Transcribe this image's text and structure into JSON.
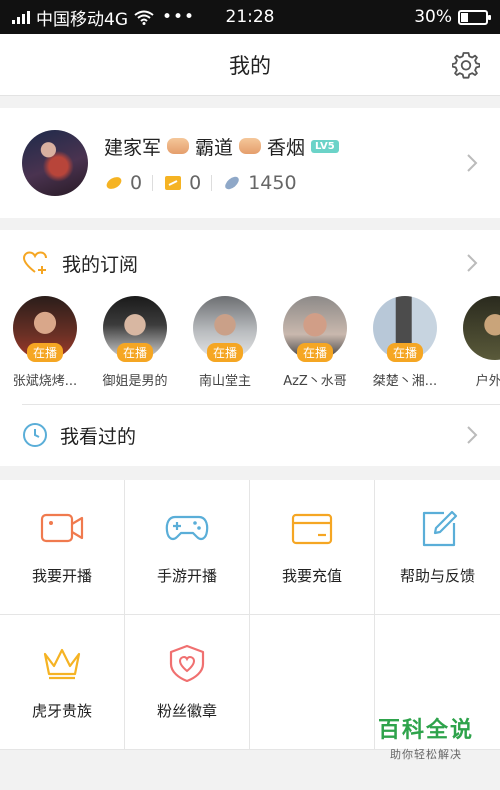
{
  "status_bar": {
    "carrier": "中国移动4G",
    "dots": "•••",
    "time": "21:28",
    "battery_percent": "30%",
    "battery_level": 0.3
  },
  "header": {
    "title": "我的",
    "settings_icon": "gear-icon"
  },
  "profile": {
    "name_parts": [
      "建家军",
      "霸道",
      "香烟"
    ],
    "level_badge": "LV5",
    "stats": [
      {
        "icon": "gold-bean-icon",
        "value": "0"
      },
      {
        "icon": "gold-ticket-icon",
        "value": "0"
      },
      {
        "icon": "silver-bean-icon",
        "value": "1450"
      }
    ]
  },
  "subscriptions": {
    "title": "我的订阅",
    "icon": "heart-plus-icon",
    "anchors": [
      {
        "name": "张斌烧烤...",
        "badge": "在播"
      },
      {
        "name": "御姐是男的",
        "badge": "在播"
      },
      {
        "name": "南山堂主",
        "badge": "在播"
      },
      {
        "name": "AzZ丶水哥",
        "badge": "在播"
      },
      {
        "name": "桀楚丶湘...",
        "badge": "在播"
      },
      {
        "name": "户外...",
        "badge": ""
      }
    ]
  },
  "history": {
    "title": "我看过的",
    "icon": "clock-icon"
  },
  "menu": [
    {
      "label": "我要开播",
      "icon": "video-camera-icon",
      "color": "#f07a4e"
    },
    {
      "label": "手游开播",
      "icon": "gamepad-icon",
      "color": "#5aaed8"
    },
    {
      "label": "我要充值",
      "icon": "wallet-card-icon",
      "color": "#f5a623"
    },
    {
      "label": "帮助与反馈",
      "icon": "edit-icon",
      "color": "#5aaed8"
    },
    {
      "label": "虎牙贵族",
      "icon": "crown-icon",
      "color": "#f5b323"
    },
    {
      "label": "粉丝徽章",
      "icon": "heart-shield-icon",
      "color": "#f07070"
    }
  ],
  "watermark": {
    "title": "百科全说",
    "subtitle": "助你轻松解决"
  },
  "colors": {
    "accent_orange": "#f5a623",
    "level_badge": "#6bd3c8",
    "watermark_green": "#2ea34b"
  }
}
